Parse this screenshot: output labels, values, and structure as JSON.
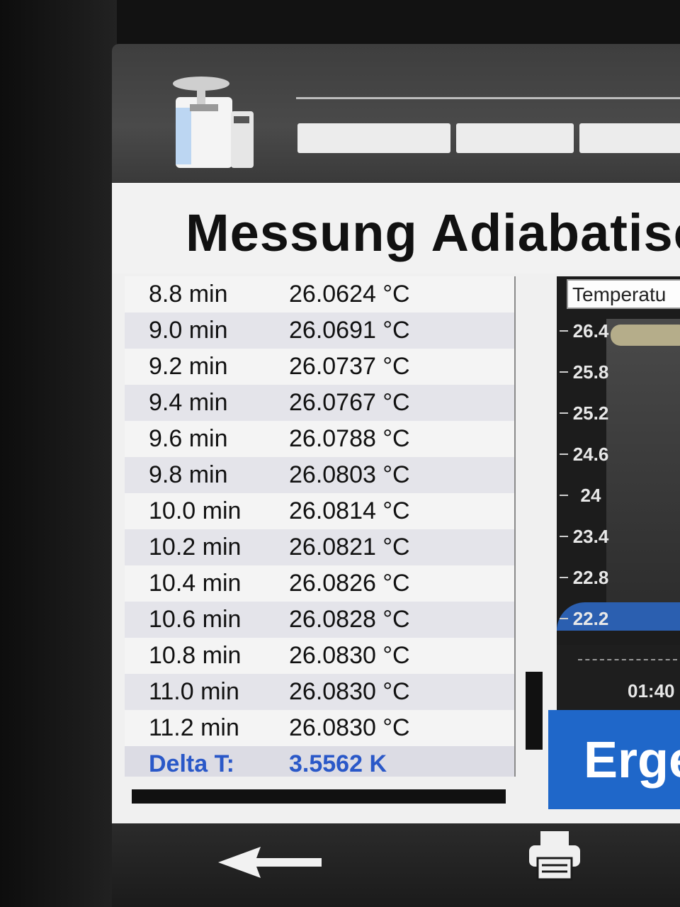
{
  "header": {
    "title": "Messung Adiabatisc"
  },
  "measurements": [
    {
      "time": "8.8 min",
      "temp": "26.0624 °C"
    },
    {
      "time": "9.0 min",
      "temp": "26.0691 °C"
    },
    {
      "time": "9.2 min",
      "temp": "26.0737 °C"
    },
    {
      "time": "9.4 min",
      "temp": "26.0767 °C"
    },
    {
      "time": "9.6 min",
      "temp": "26.0788 °C"
    },
    {
      "time": "9.8 min",
      "temp": "26.0803 °C"
    },
    {
      "time": "10.0 min",
      "temp": "26.0814 °C"
    },
    {
      "time": "10.2 min",
      "temp": "26.0821 °C"
    },
    {
      "time": "10.4 min",
      "temp": "26.0826 °C"
    },
    {
      "time": "10.6 min",
      "temp": "26.0828 °C"
    },
    {
      "time": "10.8 min",
      "temp": "26.0830 °C"
    },
    {
      "time": "11.0 min",
      "temp": "26.0830 °C"
    },
    {
      "time": "11.2 min",
      "temp": "26.0830 °C"
    }
  ],
  "delta": {
    "label": "Delta T:",
    "value": "3.5562 K"
  },
  "chart": {
    "title": "Temperatu",
    "y_ticks": [
      "26.4",
      "25.8",
      "25.2",
      "24.6",
      "24",
      "23.4",
      "22.8",
      "22.2"
    ],
    "time_label": "01:40"
  },
  "result_button": {
    "label": "Erge"
  },
  "icons": {
    "device": "calorimeter-device-icon",
    "back": "back-arrow-icon",
    "print": "printer-icon"
  },
  "colors": {
    "accent_blue": "#1f67c9",
    "delta_text": "#2a58c8"
  }
}
